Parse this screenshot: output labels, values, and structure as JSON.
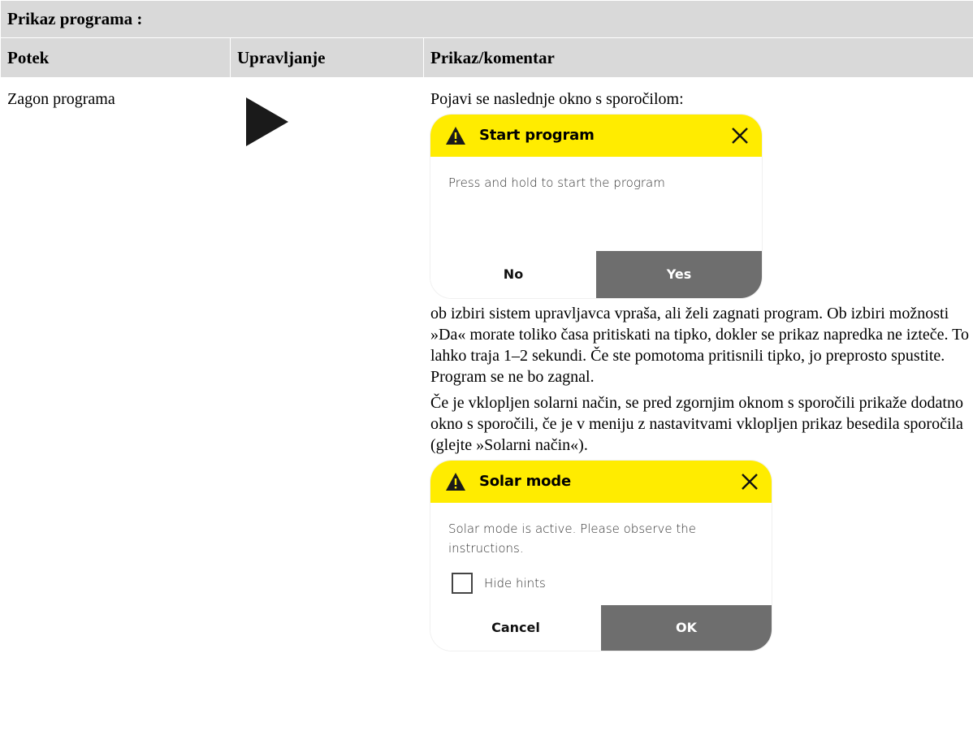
{
  "title": "Prikaz programa :",
  "headers": {
    "col1": "Potek",
    "col2": "Upravljanje",
    "col3": "Prikaz/komentar"
  },
  "row": {
    "step": "Zagon programa",
    "control_icon": "play-icon",
    "comment_intro": "Pojavi se naslednje okno s sporočilom:",
    "comment_p1": "ob izbiri sistem upravljavca vpraša, ali želi zagnati program. Ob izbiri možnosti »Da« morate toliko časa pritiskati na tipko, dokler se prikaz napredka ne izteče. To lahko traja 1–2 sekundi. Če ste pomotoma pritisnili tipko, jo preprosto spustite. Program se ne bo zagnal.",
    "comment_p2": "Če je vklopljen solarni način, se pred zgornjim oknom s sporočili prikaže dodatno okno s sporočili, če je v meniju z nastavitvami vklopljen prikaz besedila sporočila (glejte »Solarni način«)."
  },
  "dialog_start": {
    "title": "Start program",
    "message": "Press and hold to start the program",
    "no_label": "No",
    "yes_label": "Yes"
  },
  "dialog_solar": {
    "title": "Solar mode",
    "message": "Solar mode is active. Please observe the instructions.",
    "checkbox_label": "Hide hints",
    "cancel_label": "Cancel",
    "ok_label": "OK"
  },
  "colors": {
    "header_bg": "#d9d9d9",
    "dialog_header": "#ffec00",
    "primary_button": "#6e6e6e"
  }
}
